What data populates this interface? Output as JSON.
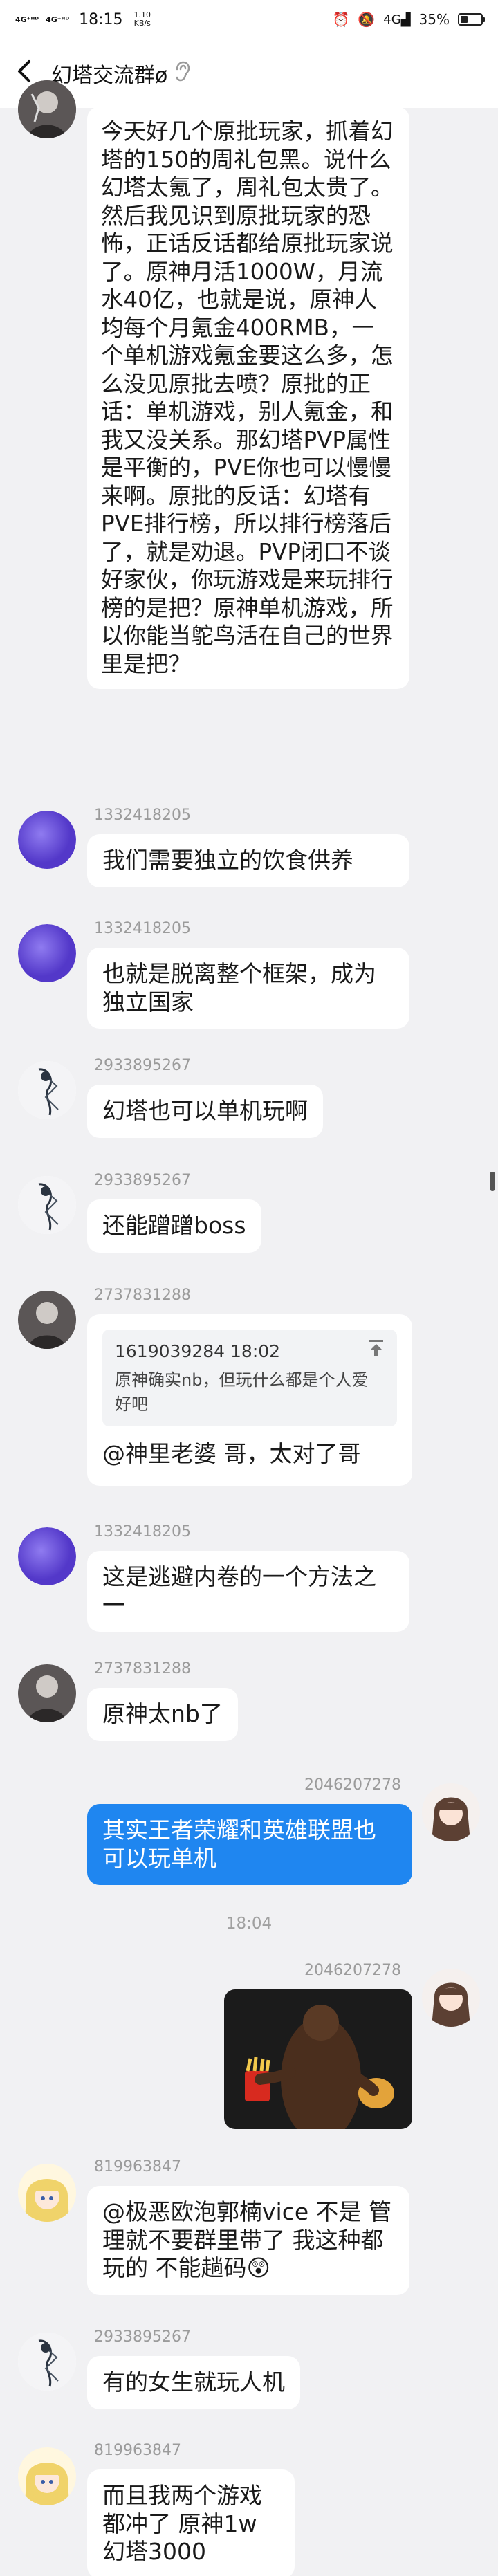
{
  "status_bar": {
    "signal_1": "4G⁺ᴴᴰ",
    "signal_2": "4G⁺ᴴᴰ",
    "time": "18:15",
    "speed_value": "1.10",
    "speed_unit": "KB/s",
    "battery_text": "35%",
    "battery_level": 0.35,
    "icons": [
      "alarm-icon",
      "silent-icon",
      "4g-signal-icon",
      "battery-icon"
    ]
  },
  "header": {
    "back_icon": "‹",
    "title": "幻塔交流群ø",
    "ear_icon": "ear-icon"
  },
  "messages": [
    {
      "id": "m0",
      "side": "left",
      "sender": "",
      "avatar": "gray-figure",
      "text": "今天好几个原批玩家，抓着幻塔的150的周礼包黑。说什么幻塔太氪了，周礼包太贵了。然后我见识到原批玩家的恐怖，正话反话都给原批玩家说了。原神月活1000W，月流水40亿，也就是说，原神人均每个月氪金400RMB，一个单机游戏氪金要这么多，怎么没见原批去喷？原批的正话：单机游戏，别人氪金，和我又没关系。那幻塔PVP属性是平衡的，PVE你也可以慢慢来啊。原批的反话：幻塔有PVE排行榜，所以排行榜落后了，就是劝退。PVP闭口不谈好家伙，你玩游戏是来玩排行榜的是把？原神单机游戏，所以你能当鸵鸟活在自己的世界里是把？"
    },
    {
      "id": "m1",
      "side": "left",
      "sender": "1332418205",
      "avatar": "purple",
      "text": "我们需要独立的饮食供养"
    },
    {
      "id": "m2",
      "side": "left",
      "sender": "1332418205",
      "avatar": "purple",
      "text": "也就是脱离整个框架，成为独立国家"
    },
    {
      "id": "m3",
      "side": "left",
      "sender": "2933895267",
      "avatar": "sketch",
      "text": "幻塔也可以单机玩啊"
    },
    {
      "id": "m4",
      "side": "left",
      "sender": "2933895267",
      "avatar": "sketch",
      "text": "还能蹭蹭boss"
    },
    {
      "id": "m5",
      "side": "left",
      "sender": "2737831288",
      "avatar": "gray-figure",
      "quote_header": "1619039284 18:02",
      "quote_text": "原神确实nb，但玩什么都是个人爱好吧",
      "text": "@神里老婆 哥，太对了哥"
    },
    {
      "id": "m6",
      "side": "left",
      "sender": "1332418205",
      "avatar": "purple",
      "text": "这是逃避内卷的一个方法之一"
    },
    {
      "id": "m7",
      "side": "left",
      "sender": "2737831288",
      "avatar": "gray-figure",
      "text": "原神太nb了"
    },
    {
      "id": "m8",
      "side": "right",
      "sender": "2046207278",
      "avatar": "anime-girl",
      "text": "其实王者荣耀和英雄联盟也可以玩单机"
    },
    {
      "id": "t1",
      "type": "timestamp",
      "text": "18:04"
    },
    {
      "id": "m9",
      "side": "right",
      "sender": "2046207278",
      "avatar": "anime-girl",
      "image": "meme-photo"
    },
    {
      "id": "m10",
      "side": "left",
      "sender": "819963847",
      "avatar": "blonde-girl",
      "text": "@极恶欧泡郭楠vice 不是 管理就不要群里带了 我这种都玩的 不能趟码😲"
    },
    {
      "id": "m11",
      "side": "left",
      "sender": "2933895267",
      "avatar": "sketch",
      "text": "有的女生就玩人机"
    },
    {
      "id": "m12",
      "side": "left",
      "sender": "819963847",
      "avatar": "blonde-girl",
      "text": "而且我两个游戏都冲了 原神1w 幻塔3000"
    }
  ],
  "colors": {
    "background": "#f1f1f3",
    "bubble_left": "#ffffff",
    "bubble_right": "#1f86f0",
    "sender_text": "#9b9b9b"
  }
}
